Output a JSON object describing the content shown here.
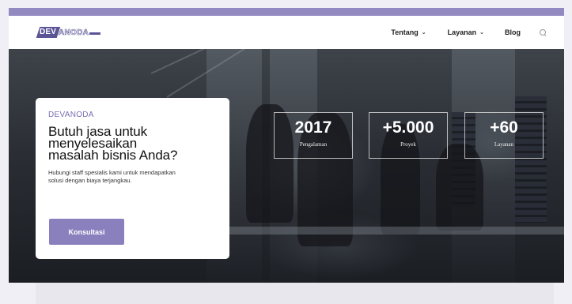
{
  "brand": {
    "logo_prefix": "DEV",
    "logo_rest": "ANODA"
  },
  "nav": {
    "items": [
      {
        "label": "Tentang",
        "has_dropdown": true
      },
      {
        "label": "Layanan",
        "has_dropdown": true
      },
      {
        "label": "Blog",
        "has_dropdown": false
      }
    ],
    "search_icon": "search-icon",
    "dropdown_glyph": "⌄"
  },
  "hero": {
    "card": {
      "brand": "DEVANODA",
      "title_lines": [
        "Butuh jasa untuk",
        "menyelesaikan",
        "masalah bisnis Anda?"
      ],
      "description_lines": [
        "Hubungi staff spesialis kami untuk mendapatkan",
        "solusi dengan biaya terjangkau."
      ],
      "button_label": "Konsultasi"
    },
    "stats": [
      {
        "value": "2017",
        "label": "Pengalaman"
      },
      {
        "value": "+5.000",
        "label": "Proyek"
      },
      {
        "value": "+60",
        "label": "Layanan"
      }
    ]
  },
  "colors": {
    "accent": "#8a80bd",
    "top_bar": "#9289c0",
    "brand_dark": "#5b5596"
  }
}
